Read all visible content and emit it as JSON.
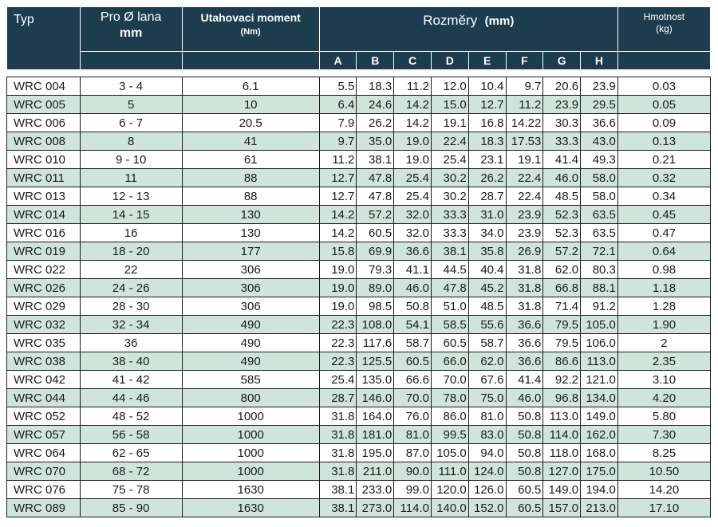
{
  "header": {
    "typ": "Typ",
    "pro_lana": "Pro Ø lana",
    "pro_unit": "mm",
    "utahovaci": "Utahovaci moment",
    "utahovaci_unit": "(Nm)",
    "rozmery": "Rozměry",
    "rozmery_unit": "(mm)",
    "hmotnost": "Hmotnost",
    "hmotnost_unit": "(kg)",
    "dims": [
      "A",
      "B",
      "C",
      "D",
      "E",
      "F",
      "G",
      "H"
    ]
  },
  "rows": [
    [
      "WRC 004",
      "3 - 4",
      "6.1",
      "5.5",
      "18.3",
      "11.2",
      "12.0",
      "10.4",
      "9.7",
      "20.6",
      "23.9",
      "0.03"
    ],
    [
      "WRC 005",
      "5",
      "10",
      "6.4",
      "24.6",
      "14.2",
      "15.0",
      "12.7",
      "11.2",
      "23.9",
      "29.5",
      "0.05"
    ],
    [
      "WRC 006",
      "6 - 7",
      "20.5",
      "7.9",
      "26.2",
      "14.2",
      "19.1",
      "16.8",
      "14.22",
      "30.3",
      "36.6",
      "0.09"
    ],
    [
      "WRC 008",
      "8",
      "41",
      "9.7",
      "35.0",
      "19.0",
      "22.4",
      "18.3",
      "17.53",
      "33.3",
      "43.0",
      "0.13"
    ],
    [
      "WRC 010",
      "9 - 10",
      "61",
      "11.2",
      "38.1",
      "19.0",
      "25.4",
      "23.1",
      "19.1",
      "41.4",
      "49.3",
      "0.21"
    ],
    [
      "WRC 011",
      "11",
      "88",
      "12.7",
      "47.8",
      "25.4",
      "30.2",
      "26.2",
      "22.4",
      "46.0",
      "58.0",
      "0.32"
    ],
    [
      "WRC 013",
      "12 - 13",
      "88",
      "12.7",
      "47.8",
      "25.4",
      "30.2",
      "28.7",
      "22.4",
      "48.5",
      "58.0",
      "0.34"
    ],
    [
      "WRC 014",
      "14 - 15",
      "130",
      "14.2",
      "57.2",
      "32.0",
      "33.3",
      "31.0",
      "23.9",
      "52.3",
      "63.5",
      "0.45"
    ],
    [
      "WRC 016",
      "16",
      "130",
      "14.2",
      "60.5",
      "32.0",
      "33.3",
      "34.0",
      "23.9",
      "52.3",
      "63.5",
      "0.47"
    ],
    [
      "WRC 019",
      "18 - 20",
      "177",
      "15.8",
      "69.9",
      "36.6",
      "38.1",
      "35.8",
      "26.9",
      "57.2",
      "72.1",
      "0.64"
    ],
    [
      "WRC 022",
      "22",
      "306",
      "19.0",
      "79.3",
      "41.1",
      "44.5",
      "40.4",
      "31.8",
      "62.0",
      "80.3",
      "0.98"
    ],
    [
      "WRC 026",
      "24 - 26",
      "306",
      "19.0",
      "89.0",
      "46.0",
      "47.8",
      "45.2",
      "31.8",
      "66.8",
      "88.1",
      "1.18"
    ],
    [
      "WRC 029",
      "28 - 30",
      "306",
      "19.0",
      "98.5",
      "50.8",
      "51.0",
      "48.5",
      "31.8",
      "71.4",
      "91.2",
      "1.28"
    ],
    [
      "WRC 032",
      "32 - 34",
      "490",
      "22.3",
      "108.0",
      "54.1",
      "58.5",
      "55.6",
      "36.6",
      "79.5",
      "105.0",
      "1.90"
    ],
    [
      "WRC 035",
      "36",
      "490",
      "22.3",
      "117.6",
      "58.7",
      "60.5",
      "58.7",
      "36.6",
      "79.5",
      "106.0",
      "2"
    ],
    [
      "WRC 038",
      "38 - 40",
      "490",
      "22.3",
      "125.5",
      "60.5",
      "66.0",
      "62.0",
      "36.6",
      "86.6",
      "113.0",
      "2.35"
    ],
    [
      "WRC 042",
      "41 - 42",
      "585",
      "25.4",
      "135.0",
      "66.6",
      "70.0",
      "67.6",
      "41.4",
      "92.2",
      "121.0",
      "3.10"
    ],
    [
      "WRC 044",
      "44 - 46",
      "800",
      "28.7",
      "146.0",
      "70.0",
      "78.0",
      "75.0",
      "46.0",
      "96.8",
      "134.0",
      "4.20"
    ],
    [
      "WRC 052",
      "48 - 52",
      "1000",
      "31.8",
      "164.0",
      "76.0",
      "86.0",
      "81.0",
      "50.8",
      "113.0",
      "149.0",
      "5.80"
    ],
    [
      "WRC 057",
      "56 - 58",
      "1000",
      "31.8",
      "181.0",
      "81.0",
      "99.5",
      "83.0",
      "50.8",
      "114.0",
      "162.0",
      "7.30"
    ],
    [
      "WRC 064",
      "62 - 65",
      "1000",
      "31.8",
      "195.0",
      "87.0",
      "105.0",
      "94.0",
      "50.8",
      "118.0",
      "168.0",
      "8.25"
    ],
    [
      "WRC 070",
      "68 - 72",
      "1000",
      "31.8",
      "211.0",
      "90.0",
      "111.0",
      "124.0",
      "50.8",
      "127.0",
      "175.0",
      "10.50"
    ],
    [
      "WRC 076",
      "75 - 78",
      "1630",
      "38.1",
      "233.0",
      "99.0",
      "120.0",
      "126.0",
      "60.5",
      "149.0",
      "194.0",
      "14.20"
    ],
    [
      "WRC 089",
      "85 - 90",
      "1630",
      "38.1",
      "273.0",
      "114.0",
      "140.0",
      "152.0",
      "60.5",
      "157.0",
      "213.0",
      "17.10"
    ]
  ],
  "colors": {
    "header_bg": "#1d3d4f",
    "row_alt_bg": "#cfe5dc",
    "row_bg": "#ffffff"
  }
}
